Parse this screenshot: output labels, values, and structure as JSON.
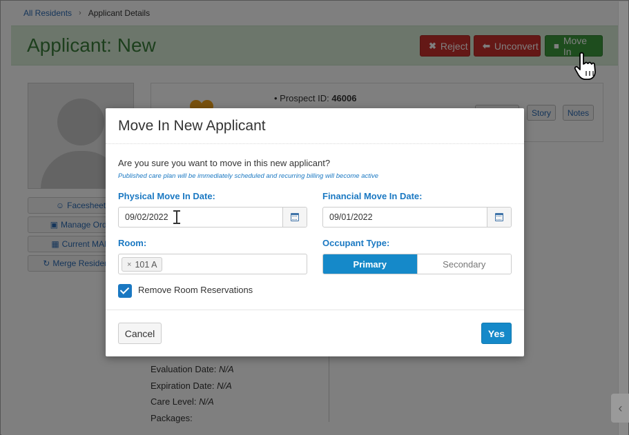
{
  "breadcrumb": {
    "root": "All Residents",
    "current": "Applicant Details"
  },
  "header": {
    "title": "Applicant: New",
    "reject_label": "Reject",
    "unconvert_label": "Unconvert",
    "move_in_label": "Move In"
  },
  "sidebar": {
    "facesheet": "Facesheet",
    "manage_orders": "Manage Orde",
    "current_mar": "Current MAR",
    "merge": "Merge Resident F"
  },
  "info": {
    "prospect_label": "Prospect ID:",
    "prospect_id": "46006",
    "story": "Story",
    "notes": "Notes"
  },
  "details": {
    "evaluation_label": "Evaluation Date:",
    "evaluation_value": "N/A",
    "expiration_label": "Expiration Date:",
    "expiration_value": "N/A",
    "care_level_label": "Care Level:",
    "care_level_value": "N/A",
    "packages_label": "Packages:"
  },
  "modal": {
    "title": "Move In New Applicant",
    "question": "Are you sure you want to move in this new applicant?",
    "note": "Published care plan will be immediately scheduled and recurring billing will become active",
    "physical_label": "Physical Move In Date:",
    "physical_value": "09/02/2022",
    "financial_label": "Financial Move In Date:",
    "financial_value": "09/01/2022",
    "room_label": "Room:",
    "room_value": "101 A",
    "occupant_label": "Occupant Type:",
    "occupant_options": [
      "Primary",
      "Secondary"
    ],
    "remove_reservations_label": "Remove Room Reservations",
    "remove_reservations_checked": true,
    "cancel_label": "Cancel",
    "yes_label": "Yes"
  },
  "colors": {
    "accent": "#1589c9",
    "danger": "#c9302c",
    "success": "#3d9a3d",
    "title_green": "#3b7f3b"
  }
}
